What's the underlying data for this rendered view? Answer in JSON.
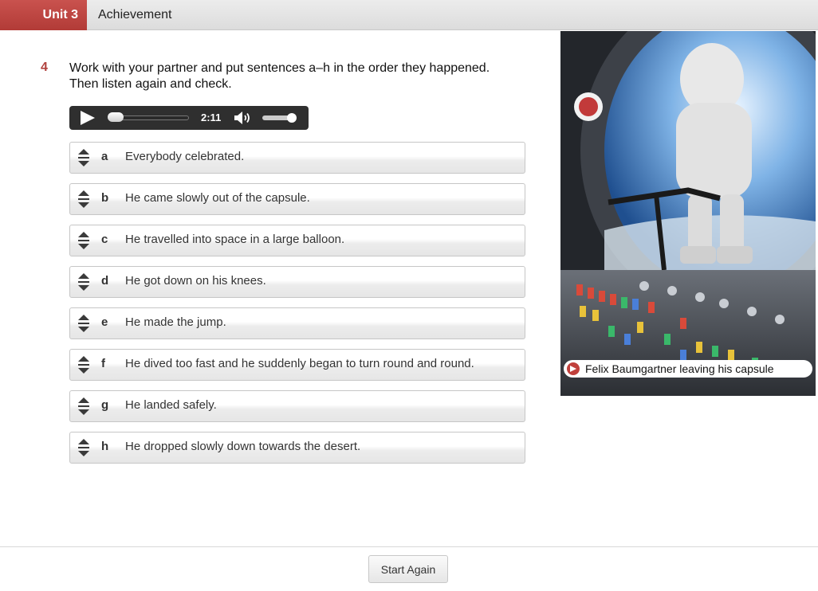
{
  "header": {
    "unit_label": "Unit 3",
    "title": "Achievement",
    "accent_color": "#b8403c"
  },
  "question": {
    "number": "4",
    "line1": "Work with your partner and put sentences a–h in the order they happened.",
    "line2": "Then listen again and check."
  },
  "player": {
    "time": "2:11",
    "play_icon": "play-icon",
    "volume_icon": "volume-icon",
    "progress": 0.0,
    "volume": 0.85
  },
  "rows": [
    {
      "letter": "a",
      "text": "Everybody celebrated."
    },
    {
      "letter": "b",
      "text": "He came slowly out of the capsule."
    },
    {
      "letter": "c",
      "text": "He travelled into space in a large balloon."
    },
    {
      "letter": "d",
      "text": "He got down on his knees."
    },
    {
      "letter": "e",
      "text": "He made the jump."
    },
    {
      "letter": "f",
      "text": "He dived too fast and he suddenly began to turn round and round."
    },
    {
      "letter": "g",
      "text": "He landed safely."
    },
    {
      "letter": "h",
      "text": "He dropped slowly down towards the desert."
    }
  ],
  "photo": {
    "caption": "Felix Baumgartner leaving his capsule"
  },
  "footer": {
    "start_again_label": "Start Again"
  }
}
